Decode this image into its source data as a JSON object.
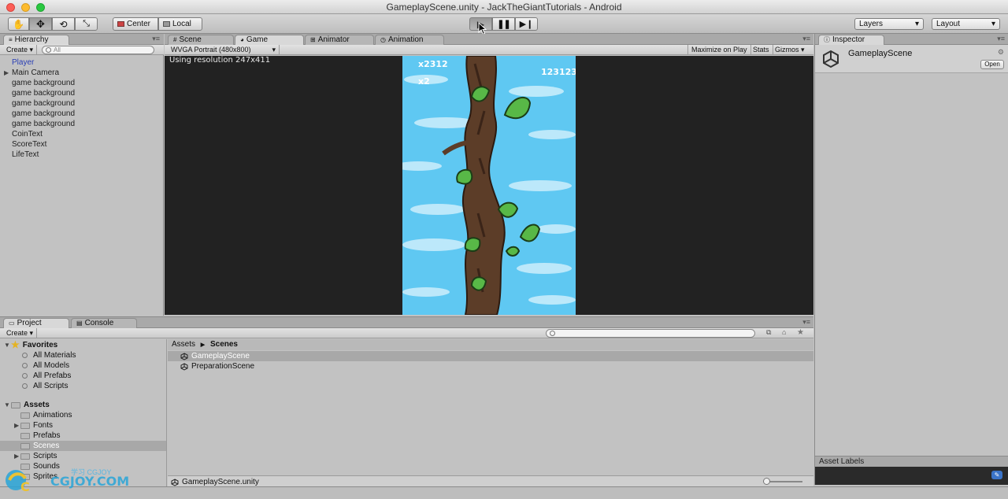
{
  "window": {
    "title": "GameplayScene.unity - JackTheGiantTutorials - Android"
  },
  "toolbar": {
    "tools": [
      "hand-tool",
      "move-tool",
      "rotate-tool",
      "scale-tool"
    ],
    "pivot_label": "Center",
    "space_label": "Local",
    "layers_label": "Layers",
    "layout_label": "Layout"
  },
  "hierarchy": {
    "tab": "Hierarchy",
    "create_label": "Create",
    "search_placeholder": "All",
    "items": [
      "Player",
      "Main Camera",
      "game background",
      "game background",
      "game background",
      "game background",
      "game background",
      "CoinText",
      "ScoreText",
      "LifeText"
    ]
  },
  "center_tabs": [
    "Scene",
    "Game",
    "Animator",
    "Animation"
  ],
  "game": {
    "aspect_label": "WVGA Portrait (480x800)",
    "maximize_label": "Maximize on Play",
    "stats_label": "Stats",
    "gizmos_label": "Gizmos",
    "resolution_text": "Using resolution 247x411",
    "hud_coins": "x2312",
    "hud_lives": "x2",
    "hud_score": "123123"
  },
  "inspector": {
    "tab": "Inspector",
    "asset_name": "GameplayScene",
    "open_label": "Open",
    "asset_labels": "Asset Labels"
  },
  "project": {
    "tab": "Project",
    "console_tab": "Console",
    "create_label": "Create",
    "favorites_label": "Favorites",
    "favorites": [
      "All Materials",
      "All Models",
      "All Prefabs",
      "All Scripts"
    ],
    "assets_label": "Assets",
    "folders": [
      "Animations",
      "Fonts",
      "Prefabs",
      "Scenes",
      "Scripts",
      "Sounds",
      "Sprites"
    ],
    "breadcrumb": [
      "Assets",
      "Scenes"
    ],
    "files": [
      "GameplayScene",
      "PreparationScene"
    ],
    "footer_file": "GameplayScene.unity"
  },
  "watermark": {
    "text1": "学习 CGJOY",
    "text2": "CGJOY.COM"
  },
  "colors": {
    "sky": "#5fc8f2",
    "selection": "#a8a8a8",
    "player_blue": "#2a3fb5"
  }
}
